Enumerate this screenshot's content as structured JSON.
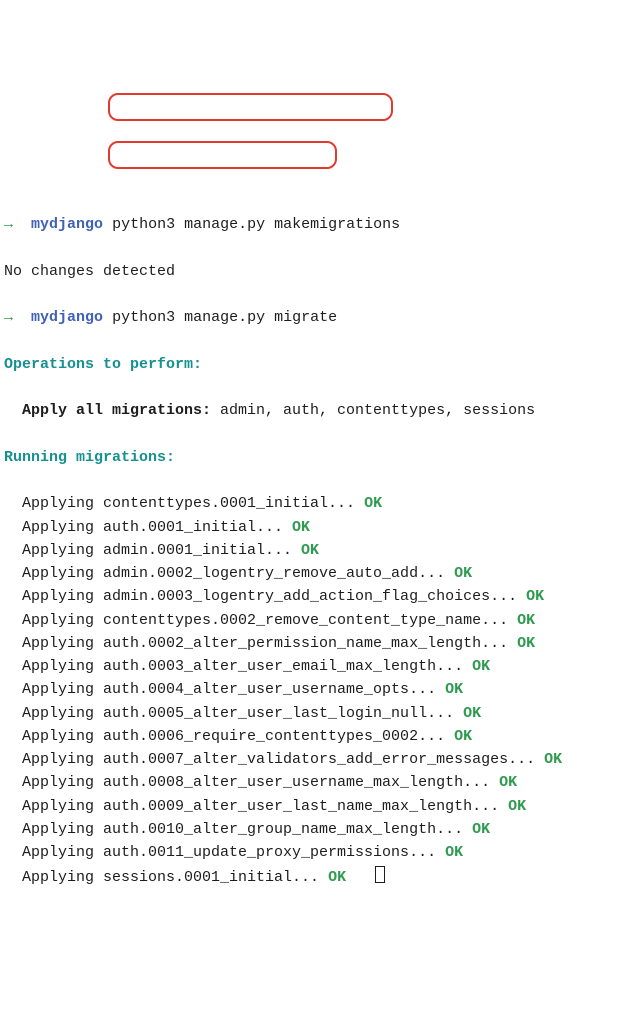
{
  "colors": {
    "arrow_ok": "#2e9b4f",
    "prompt": "#3f62b8",
    "heading": "#179090",
    "highlight_border": "#e23a2f"
  },
  "prompt1": {
    "arrow": "→",
    "dir": "mydjango",
    "command": "python3 manage.py makemigrations"
  },
  "out1": "No changes detected",
  "prompt2": {
    "arrow": "→",
    "dir": "mydjango",
    "command": "python3 manage.py migrate"
  },
  "ops_header": "Operations to perform:",
  "ops_line_label": "Apply all migrations:",
  "ops_line_targets": " admin, auth, contenttypes, sessions",
  "run_header": "Running migrations:",
  "applying_label": "Applying ",
  "dots": "...",
  "ok_label": "OK",
  "migrations": [
    "contenttypes.0001_initial",
    "auth.0001_initial",
    "admin.0001_initial",
    "admin.0002_logentry_remove_auto_add",
    "admin.0003_logentry_add_action_flag_choices",
    "contenttypes.0002_remove_content_type_name",
    "auth.0002_alter_permission_name_max_length",
    "auth.0003_alter_user_email_max_length",
    "auth.0004_alter_user_username_opts",
    "auth.0005_alter_user_last_login_null",
    "auth.0006_require_contenttypes_0002",
    "auth.0007_alter_validators_add_error_messages",
    "auth.0008_alter_user_username_max_length",
    "auth.0009_alter_user_last_name_max_length",
    "auth.0010_alter_group_name_max_length",
    "auth.0011_update_proxy_permissions",
    "sessions.0001_initial"
  ]
}
